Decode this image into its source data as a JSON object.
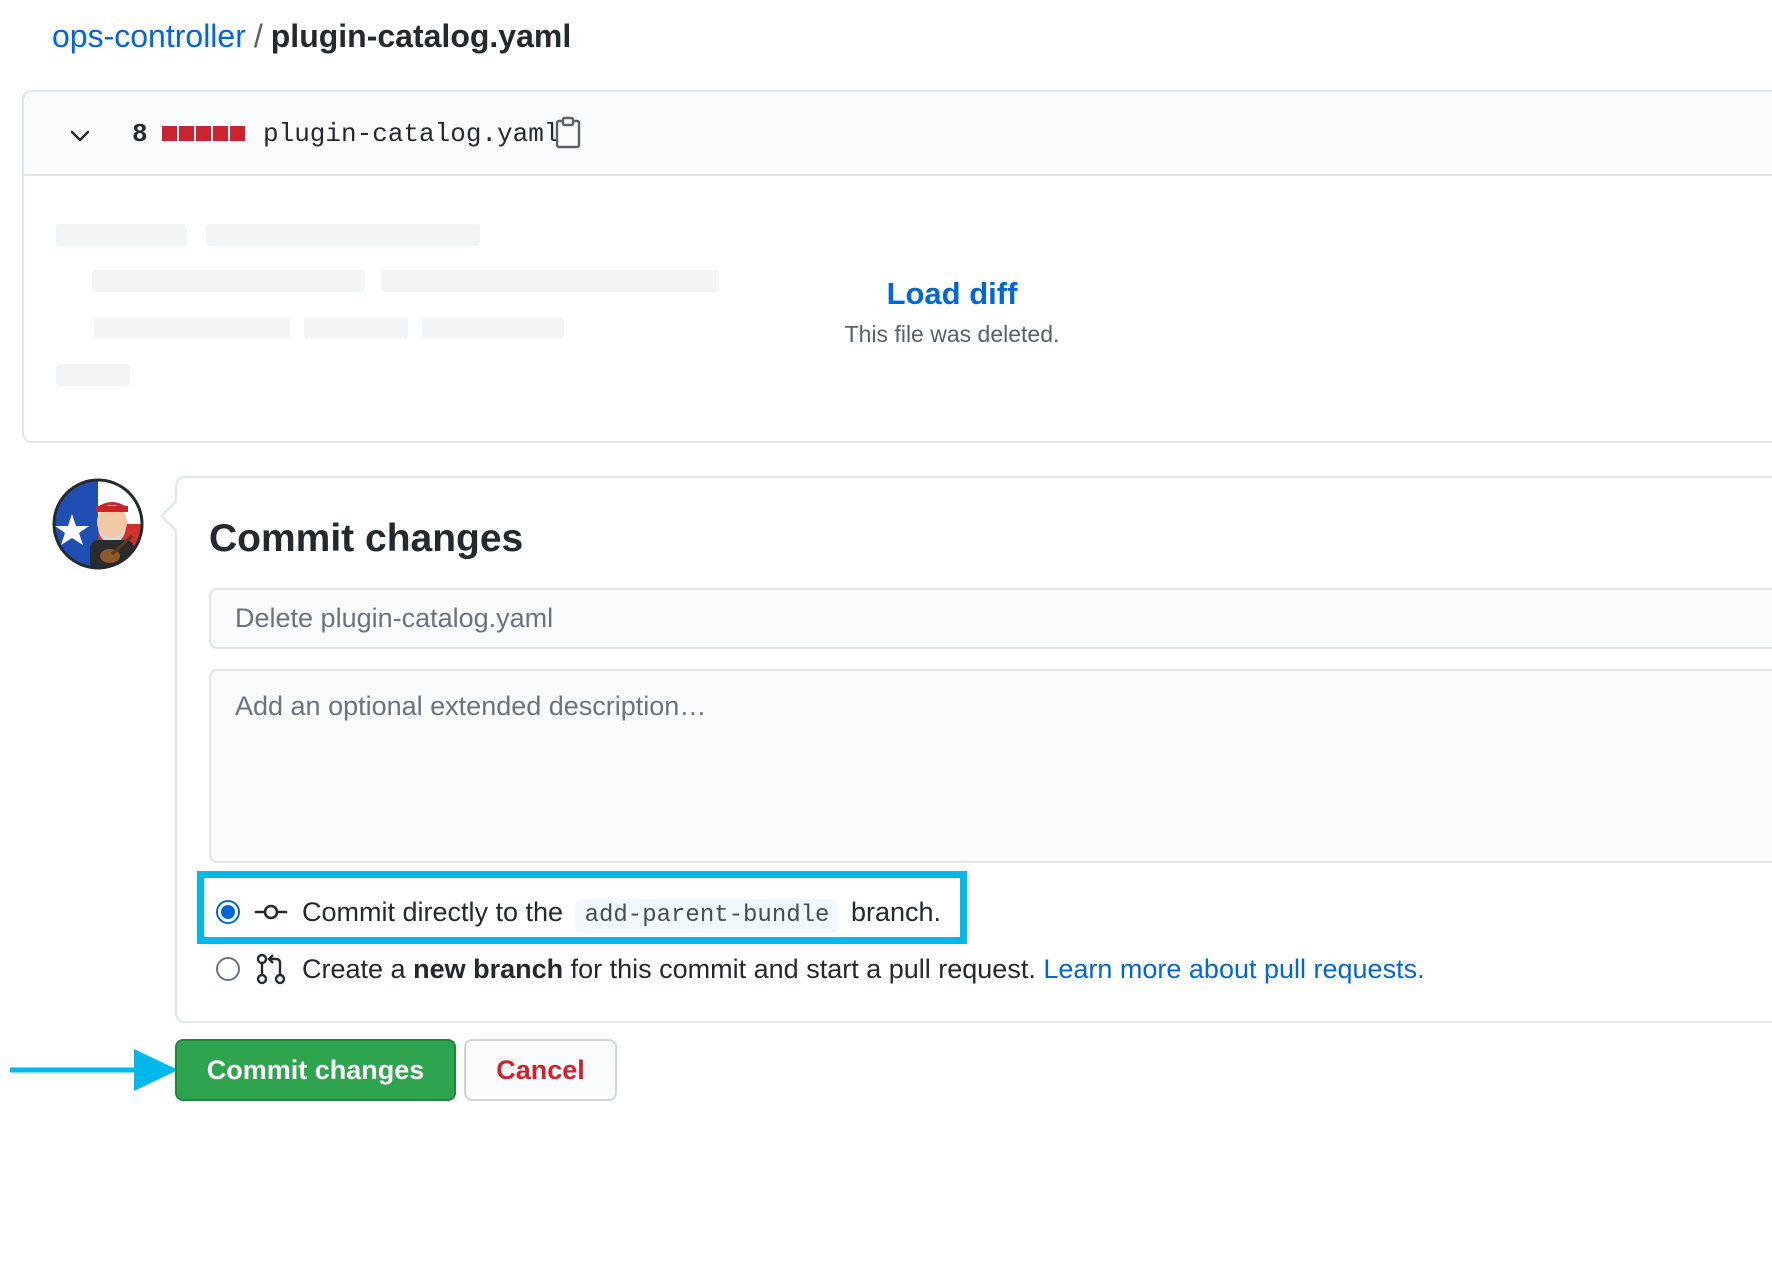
{
  "breadcrumb": {
    "repo": "ops-controller",
    "separator": "/",
    "file": "plugin-catalog.yaml"
  },
  "file_diff": {
    "deletion_count": "8",
    "diffstat_color": "#cb2431",
    "file_name": "plugin-catalog.yaml",
    "load_diff_label": "Load diff",
    "status_note": "This file was deleted."
  },
  "commit_form": {
    "title": "Commit changes",
    "summary_placeholder": "Delete plugin-catalog.yaml",
    "description_placeholder": "Add an optional extended description…",
    "options": {
      "direct": {
        "selected": true,
        "text_before": "Commit directly to the",
        "branch": "add-parent-bundle",
        "text_after": "branch."
      },
      "new_branch": {
        "selected": false,
        "text_before": "Create a",
        "bold": "new branch",
        "text_after": "for this commit and start a pull request.",
        "link": "Learn more about pull requests."
      }
    }
  },
  "buttons": {
    "commit": "Commit changes",
    "cancel": "Cancel"
  },
  "annotations": {
    "highlight_color": "#00b9ec",
    "arrow_color": "#00b9ec"
  },
  "colors": {
    "link": "#0366d6",
    "primary_button": "#2ea44f",
    "danger": "#cb2431"
  }
}
